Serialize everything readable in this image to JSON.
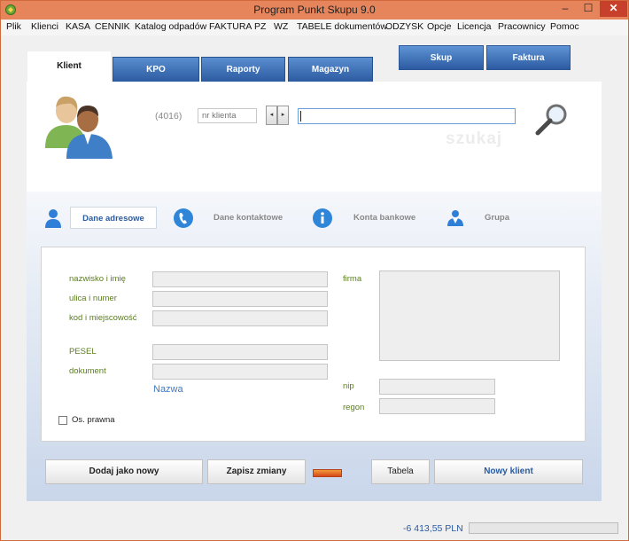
{
  "window": {
    "title": "Program Punkt Skupu 9.0",
    "min_glyph": "–",
    "max_glyph": "☐",
    "close_glyph": "✕"
  },
  "menu": [
    "Plik",
    "Klienci",
    "KASA",
    "CENNIK",
    "Katalog odpadów",
    "FAKTURA",
    "PZ",
    "WZ",
    "TABELE dokumentów",
    "ODZYSK",
    "Opcje",
    "Licencja",
    "Pracownicy",
    "Pomoc"
  ],
  "tabs": {
    "klient": "Klient",
    "kpo": "KPO",
    "raporty": "Raporty",
    "magazyn": "Magazyn"
  },
  "top_buttons": {
    "skup": "Skup",
    "faktura": "Faktura"
  },
  "search": {
    "client_count": "(4016)",
    "nr_klienta_placeholder": "nr klienta",
    "nav_prev": "◂",
    "nav_next": "▸",
    "watermark": "szukaj"
  },
  "subtabs": {
    "dane_adresowe": "Dane adresowe",
    "dane_kontaktowe": "Dane kontaktowe",
    "konta_bankowe": "Konta bankowe",
    "grupa": "Grupa"
  },
  "form": {
    "nazwisko": "nazwisko i imię",
    "ulica": "ulica i numer",
    "kod": "kod i miejscowość",
    "pesel": "PESEL",
    "dokument": "dokument",
    "nazwa": "Nazwa",
    "firma": "firma",
    "nip": "nip",
    "regon": "regon",
    "os_prawna": "Os. prawna"
  },
  "buttons": {
    "dodaj": "Dodaj jako nowy",
    "zapisz": "Zapisz zmiany",
    "tabela": "Tabela",
    "nowy_klient": "Nowy klient"
  },
  "status": {
    "balance": "-6 413,55 PLN"
  },
  "colors": {
    "titlebar": "#e6855b",
    "tab_blue": "#2c5aa0",
    "label_green": "#5a7d1e",
    "indicator_orange": "#e0662a"
  }
}
